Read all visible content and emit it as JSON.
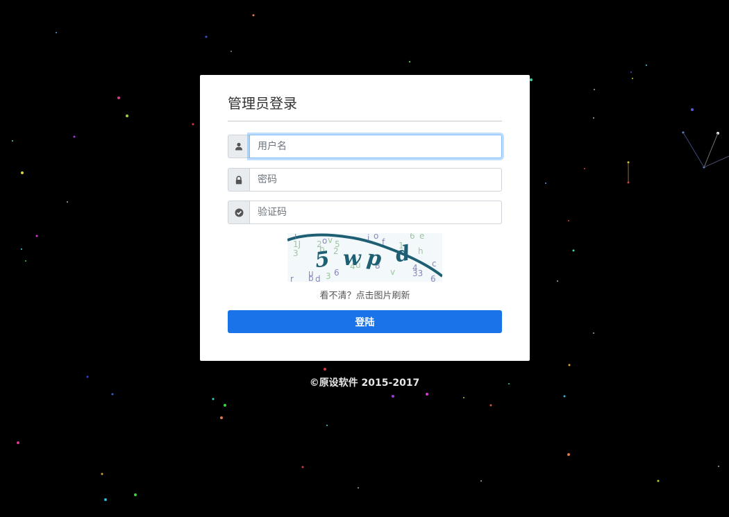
{
  "login": {
    "title": "管理员登录",
    "username": {
      "placeholder": "用户名",
      "value": "",
      "icon": "user-icon"
    },
    "password": {
      "placeholder": "密码",
      "value": "",
      "icon": "lock-icon"
    },
    "captcha_field": {
      "placeholder": "验证码",
      "value": "",
      "icon": "check-circle-icon"
    },
    "captcha_hint": "看不清？点击图片刷新",
    "submit_label": "登陆"
  },
  "footer": {
    "copyright": "©原设软件 2015-2017"
  },
  "colors": {
    "background": "#000000",
    "card": "#ffffff",
    "primary_button": "#1a73e8",
    "focus_border": "#80bdff"
  }
}
